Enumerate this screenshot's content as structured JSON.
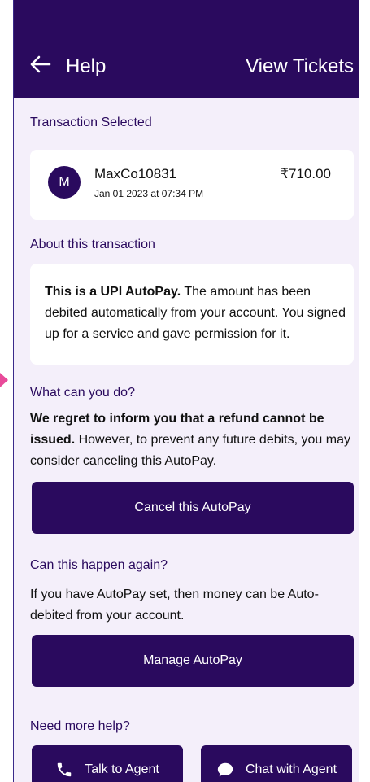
{
  "header": {
    "title": "Help",
    "view_tickets": "View Tickets"
  },
  "transaction": {
    "section_label": "Transaction Selected",
    "avatar_letter": "M",
    "merchant": "MaxCo10831",
    "date": "Jan 01 2023 at 07:34 PM",
    "amount": "₹710.00"
  },
  "about": {
    "section_label": "About this transaction",
    "bold": "This is a UPI AutoPay.",
    "text": " The amount has been debited automatically from your account. You signed up for a service and gave permission for it."
  },
  "what_can_you_do": {
    "section_label": "What can you do?",
    "bold": "We regret to inform you that a refund cannot be issued.",
    "text": " However, to prevent any future debits, you may consider canceling this AutoPay.",
    "button": "Cancel this AutoPay"
  },
  "happen_again": {
    "section_label": "Can this happen again?",
    "text": "If you have AutoPay set, then money can be Auto-debited from your account.",
    "button": "Manage AutoPay"
  },
  "more_help": {
    "section_label": "Need more help?",
    "talk_agent": "Talk to Agent",
    "chat_agent": "Chat with Agent"
  },
  "colors": {
    "primary": "#2a0a5e",
    "background": "#f4effa"
  }
}
